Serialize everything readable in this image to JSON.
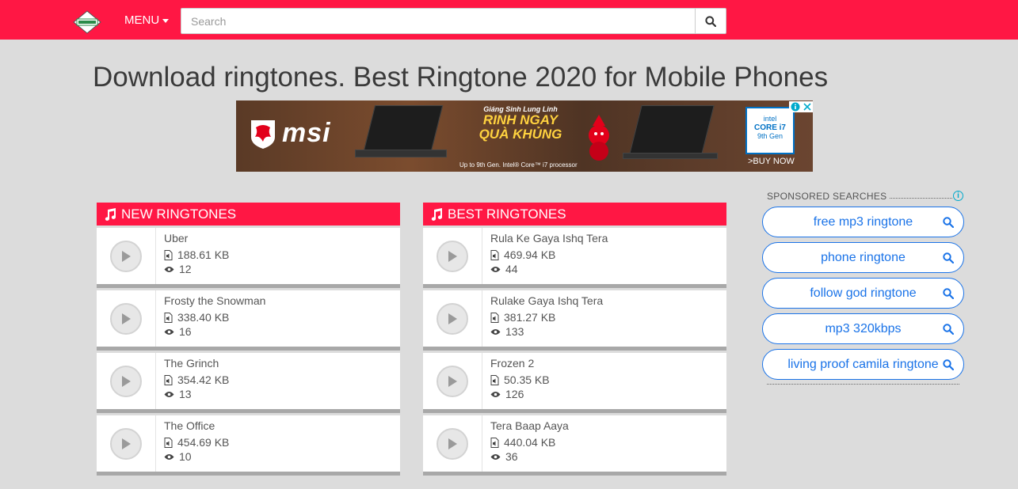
{
  "header": {
    "menu_label": "MENU",
    "search_placeholder": "Search"
  },
  "page_title": "Download ringtones. Best Ringtone 2020 for Mobile Phones",
  "ad": {
    "brand": "msi",
    "promo_line1": "Giáng Sinh Lung Linh",
    "promo_line2": "RINH NGAY",
    "promo_line3": "QUÀ KHỦNG",
    "fine_print": "Up to 9th Gen. Intel® Core™ i7 processor",
    "intel_brand": "intel",
    "intel_cpu": "CORE i7",
    "intel_gen": "9th Gen",
    "cta": ">BUY NOW"
  },
  "new_ringtones": {
    "title": "NEW RINGTONES",
    "items": [
      {
        "name": "Uber",
        "size": "188.61 KB",
        "views": "12"
      },
      {
        "name": "Frosty the Snowman",
        "size": "338.40 KB",
        "views": "16"
      },
      {
        "name": "The Grinch",
        "size": "354.42 KB",
        "views": "13"
      },
      {
        "name": "The Office",
        "size": "454.69 KB",
        "views": "10"
      }
    ]
  },
  "best_ringtones": {
    "title": "BEST RINGTONES",
    "items": [
      {
        "name": "Rula Ke Gaya Ishq Tera",
        "size": "469.94 KB",
        "views": "44"
      },
      {
        "name": "Rulake Gaya Ishq Tera",
        "size": "381.27 KB",
        "views": "133"
      },
      {
        "name": "Frozen 2",
        "size": "50.35 KB",
        "views": "126"
      },
      {
        "name": "Tera Baap Aaya",
        "size": "440.04 KB",
        "views": "36"
      }
    ]
  },
  "sponsored": {
    "label": "SPONSORED SEARCHES",
    "items": [
      "free mp3 ringtone",
      "phone ringtone",
      "follow god ringtone",
      "mp3 320kbps",
      "living proof camila ringtone"
    ]
  },
  "colors": {
    "brand_red": "#ff1744",
    "link_blue": "#1a73e8",
    "page_bg": "#dcdcdc"
  }
}
